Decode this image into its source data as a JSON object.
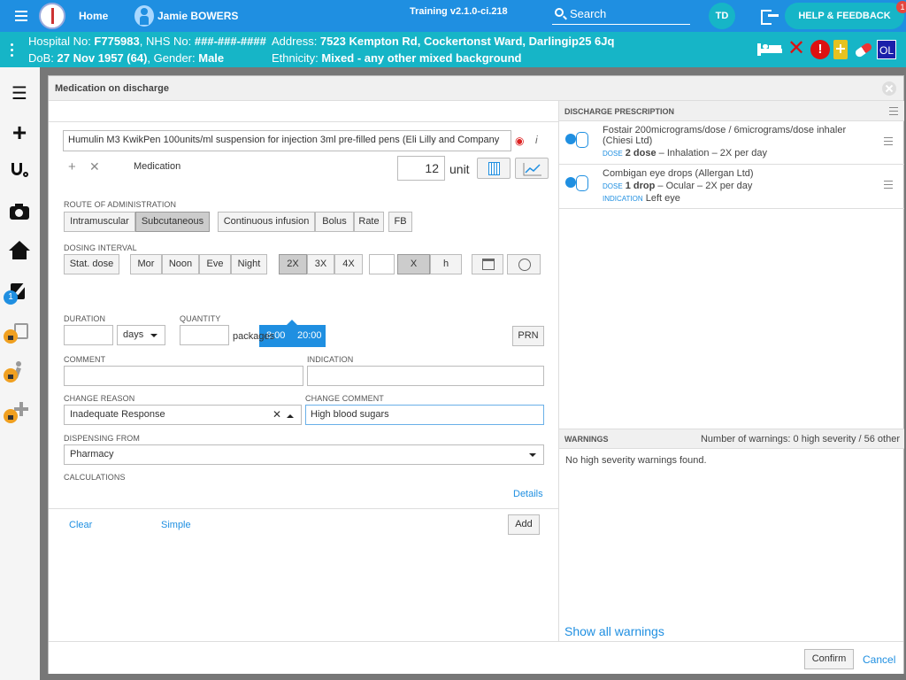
{
  "topbar": {
    "home": "Home",
    "patient_name": "Jamie BOWERS",
    "version": "Training v2.1.0-ci.218",
    "search": "Search",
    "avatar": "TD",
    "help": "HELP & FEEDBACK",
    "notif_count": "1"
  },
  "banner": {
    "hosp_label": "Hospital No: ",
    "hosp_value": "F775983",
    "nhs_label": ", NHS No: ",
    "nhs_value": "###-###-####",
    "dob_label": "DoB: ",
    "dob_value": "27 Nov 1957 (64)",
    "gender_label": ", Gender: ",
    "gender_value": "Male",
    "addr_label": "Address: ",
    "addr_value": "7523 Kempton Rd, Cockertonst Ward, Darlingip25 6Jq",
    "eth_label": "Ethnicity: ",
    "eth_value": "Mixed - any other mixed background",
    "ol": "OL"
  },
  "sidebar": {
    "badge": "1"
  },
  "modal": {
    "title": "Medication on discharge",
    "medication": "Humulin M3 KwikPen 100units/ml suspension for injection 3ml pre-filled pens (Eli Lilly and Company",
    "medication_label": "Medication",
    "qty": "12",
    "unit": "unit",
    "route_label": "ROUTE OF ADMINISTRATION",
    "routes": [
      "Intramuscular",
      "Subcutaneous"
    ],
    "route_extra": [
      "Continuous infusion",
      "Bolus",
      "Rate"
    ],
    "fb": "FB",
    "dosing_label": "DOSING INTERVAL",
    "stat": "Stat. dose",
    "times_of_day": [
      "Mor",
      "Noon",
      "Eve",
      "Night"
    ],
    "freq": [
      "2X",
      "3X",
      "4X"
    ],
    "x_btn": "X",
    "h_btn": "h",
    "dose_times": [
      "8:00",
      "20:00"
    ],
    "duration_label": "DURATION",
    "days": "days",
    "quantity_label": "QUANTITY",
    "packages": "packages",
    "prn": "PRN",
    "comment_label": "COMMENT",
    "indication_label": "INDICATION",
    "change_reason_label": "CHANGE REASON",
    "change_reason": "Inadequate Response",
    "change_comment_label": "CHANGE COMMENT",
    "change_comment": "High blood sugars",
    "dispensing_label": "DISPENSING FROM",
    "dispensing": "Pharmacy",
    "calculations_label": "CALCULATIONS",
    "details": "Details",
    "clear": "Clear",
    "simple": "Simple",
    "add": "Add",
    "confirm": "Confirm",
    "cancel": "Cancel"
  },
  "prescription": {
    "header": "DISCHARGE PRESCRIPTION",
    "items": [
      {
        "name": "Fostair 200micrograms/dose / 6micrograms/dose inhaler (Chiesi Ltd)",
        "dose_label": "DOSE",
        "dose": "2 dose",
        "detail": " – Inhalation – 2X per day"
      },
      {
        "name": "Combigan eye drops (Allergan Ltd)",
        "dose_label": "DOSE",
        "dose": "1 drop",
        "detail": " – Ocular – 2X per day",
        "ind_label": "INDICATION",
        "indication": "Left eye"
      }
    ]
  },
  "warnings": {
    "header": "WARNINGS",
    "count": "Number of warnings: 0 high severity / 56 other",
    "message": "No high severity warnings found.",
    "show_all": "Show all warnings"
  },
  "colors": {
    "primary": "#1f8fe1",
    "banner": "#16b5c7",
    "alert": "#e5463c"
  }
}
